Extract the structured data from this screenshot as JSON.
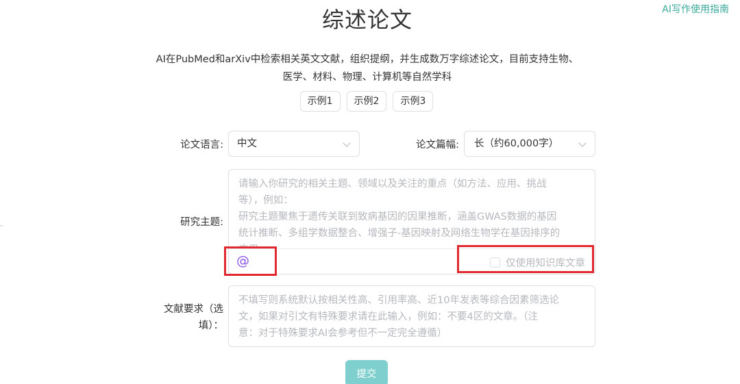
{
  "guide_link": "AI写作使用指南",
  "title": "综述论文",
  "description_lines": [
    "AI在PubMed和arXiv中检索相关英文文献，组织提纲，并生成数万字综述论文，目前支持生物、",
    "医学、材料、物理、计算机等自然学科"
  ],
  "examples": [
    "示例1",
    "示例2",
    "示例3"
  ],
  "language": {
    "label": "论文语言:",
    "value": "中文"
  },
  "length": {
    "label": "论文篇幅:",
    "value": "长（约60,000字）"
  },
  "topic": {
    "label": "研究主题:",
    "placeholder_lines": [
      "请输入你研究的相关主题、领域以及关注的重点（如方法、应用、挑战",
      "等），例如：",
      "研究主题聚焦于遗传关联到致病基因的因果推断，涵盖GWAS数据的基因",
      "统计推断、多组学数据整合、增强子-基因映射及网络生物学在基因排序的",
      "应用。"
    ],
    "mention_symbol": "@",
    "kb_only_label": "仅使用知识库文章",
    "kb_only_checked": false
  },
  "literature": {
    "label_lines": [
      "文献要求（选",
      "填）："
    ],
    "placeholder_lines": [
      "不填写则系统默认按相关性高、引用率高、近10年发表等综合因素筛选论",
      "文，如果对引文有特殊要求请在此输入，例如：不要4区的文章。（注",
      "意：对于特殊要求AI会参考但不一定完全遵循）"
    ]
  },
  "submit_label": "提交",
  "edge_glyph": "·",
  "colors": {
    "accent": "#3aa99b",
    "submit_bg": "#7fcfcf",
    "highlight_red": "#e0282e",
    "mention_purple": "#8a55e8"
  }
}
